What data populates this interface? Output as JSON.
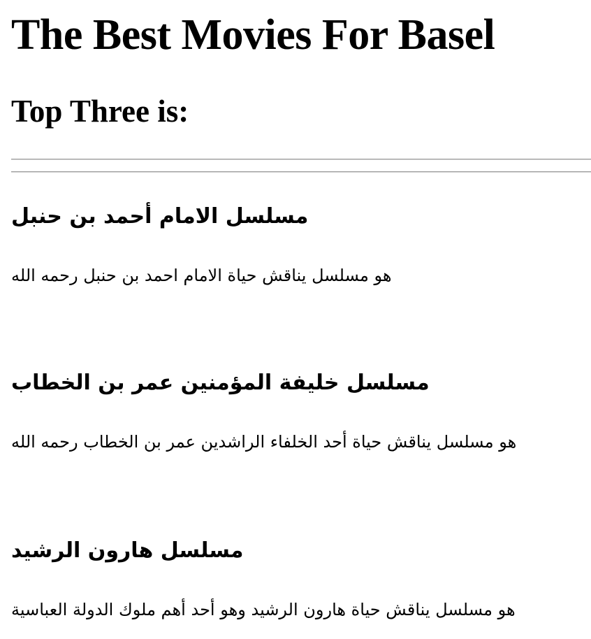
{
  "page": {
    "title": "The Best Movies For Basel",
    "subtitle": "Top Three is:"
  },
  "movies": [
    {
      "title": "مسلسل الامام أحمد بن حنبل",
      "description": "هو مسلسل يناقش حياة الامام احمد بن حنبل رحمه الله"
    },
    {
      "title": "مسلسل خليفة المؤمنين عمر بن الخطاب",
      "description": "هو مسلسل يناقش حياة أحد الخلفاء الراشدين عمر بن الخطاب رحمه الله"
    },
    {
      "title": "مسلسل هارون الرشيد",
      "description": "هو مسلسل يناقش حياة هارون الرشيد وهو أحد أهم ملوك الدولة العباسية"
    }
  ]
}
